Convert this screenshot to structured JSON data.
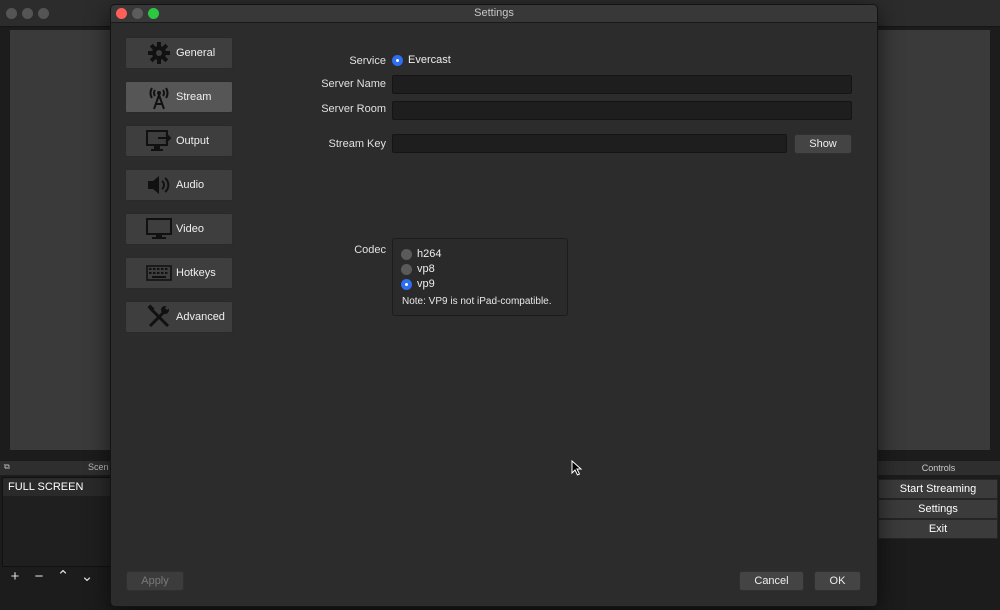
{
  "window": {
    "title": "Settings"
  },
  "sidebar": {
    "items": [
      {
        "label": "General",
        "icon": "gear-icon"
      },
      {
        "label": "Stream",
        "icon": "antenna-icon",
        "active": true
      },
      {
        "label": "Output",
        "icon": "output-icon"
      },
      {
        "label": "Audio",
        "icon": "speaker-icon"
      },
      {
        "label": "Video",
        "icon": "monitor-icon"
      },
      {
        "label": "Hotkeys",
        "icon": "keyboard-icon"
      },
      {
        "label": "Advanced",
        "icon": "tools-icon"
      }
    ]
  },
  "stream": {
    "service_label": "Service",
    "service_value": "Evercast",
    "server_name_label": "Server Name",
    "server_name_value": "",
    "server_room_label": "Server Room",
    "server_room_value": "",
    "stream_key_label": "Stream Key",
    "stream_key_value": "",
    "show_button": "Show",
    "codec_label": "Codec",
    "codec_options": [
      {
        "label": "h264",
        "selected": false
      },
      {
        "label": "vp8",
        "selected": false
      },
      {
        "label": "vp9",
        "selected": true
      }
    ],
    "codec_note": "Note: VP9 is not iPad-compatible."
  },
  "footer": {
    "apply": "Apply",
    "cancel": "Cancel",
    "ok": "OK"
  },
  "background": {
    "scenes_header": "Scen",
    "scene_item": "FULL SCREEN",
    "controls_header": "Controls",
    "start_streaming": "Start Streaming",
    "settings": "Settings",
    "exit": "Exit"
  },
  "colors": {
    "accent": "#2d6ef2",
    "window_bg": "#2d2c2c",
    "close": "#fe5f57",
    "zoom": "#2bc840"
  }
}
